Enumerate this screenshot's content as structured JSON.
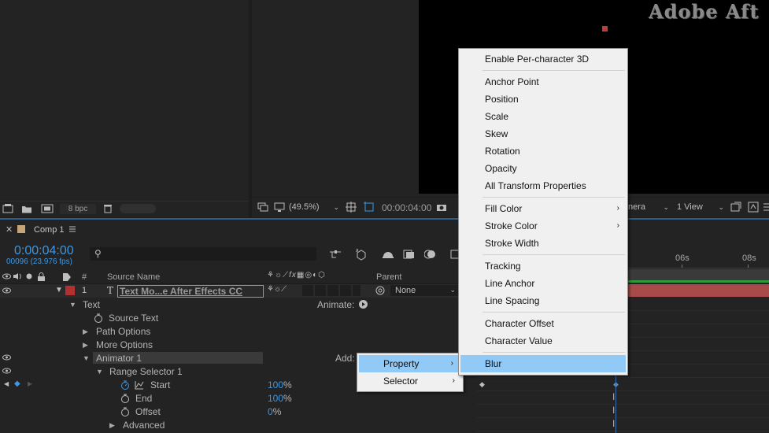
{
  "project_panel": {
    "bpc": "8 bpc"
  },
  "viewer": {
    "watermark": "Adobe Aft",
    "zoom": "(49.5%)",
    "timecode": "00:00:04:00",
    "camera": "nera",
    "views": "1 View"
  },
  "timeline": {
    "tab_label": "Comp 1",
    "timecode": "0:00:04:00",
    "frame_info": "00096 (23.976 fps)",
    "search_placeholder": "",
    "col_hash": "#",
    "col_source_name": "Source Name",
    "col_parent": "Parent",
    "ruler_labels": [
      "06s",
      "08s"
    ],
    "layer": {
      "number": "1",
      "type_icon": "T",
      "name": "Text Mo...e After Effects CC",
      "parent_value": "None"
    },
    "rows": {
      "text": "Text",
      "animate_label": "Animate:",
      "source_text": "Source Text",
      "path_options": "Path Options",
      "more_options": "More Options",
      "animator": "Animator 1",
      "add_label": "Add:",
      "range_selector": "Range Selector 1",
      "start": "Start",
      "start_value": "100",
      "end": "End",
      "end_value": "100",
      "offset": "Offset",
      "offset_value": "0",
      "percent": "%",
      "advanced": "Advanced"
    }
  },
  "context_menu": {
    "items": [
      {
        "label": "Enable Per-character 3D"
      },
      {
        "label": "Anchor Point"
      },
      {
        "label": "Position"
      },
      {
        "label": "Scale"
      },
      {
        "label": "Skew"
      },
      {
        "label": "Rotation"
      },
      {
        "label": "Opacity"
      },
      {
        "label": "All Transform Properties"
      },
      {
        "label": "Fill Color"
      },
      {
        "label": "Stroke Color"
      },
      {
        "label": "Stroke Width"
      },
      {
        "label": "Tracking"
      },
      {
        "label": "Line Anchor"
      },
      {
        "label": "Line Spacing"
      },
      {
        "label": "Character Offset"
      },
      {
        "label": "Character Value"
      },
      {
        "label": "Blur"
      }
    ]
  },
  "add_menu": {
    "property": "Property",
    "selector": "Selector"
  },
  "colors": {
    "accent_blue": "#3d97e4",
    "menu_highlight": "#91c9f7",
    "layer_label_red": "#b33030",
    "work_area_green": "#2e9c3a"
  }
}
